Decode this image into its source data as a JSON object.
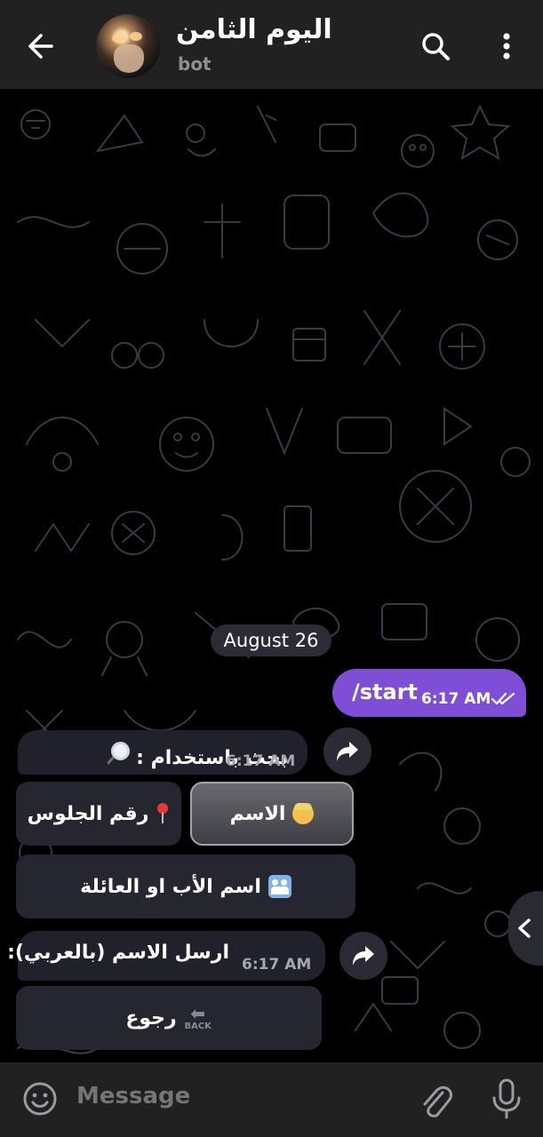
{
  "header": {
    "title": "اليوم الثامن",
    "subtitle": "bot",
    "icons": {
      "back": "arrow-left",
      "search": "search",
      "menu": "more-vertical"
    }
  },
  "chat": {
    "date_chip": "August 26",
    "outgoing": {
      "text": "/start",
      "time": "6:17 AM",
      "status": "read"
    },
    "incoming_1": {
      "text": "🔎 بحث باستخدام :",
      "text_main": "بحث باستخدام :",
      "time": "6:17 AM"
    },
    "keyboard_1": {
      "name_label": "الاسم",
      "seat_label": "رقم الجلوس",
      "father_label": "اسم الأب او العائلة"
    },
    "incoming_2": {
      "text": "ارسل الاسم (بالعربي):",
      "time": "6:17 AM"
    },
    "keyboard_2": {
      "back_label": "رجوع",
      "back_icon_text": "BACK"
    }
  },
  "input": {
    "placeholder": "Message"
  },
  "colors": {
    "header": "#212121",
    "accent": "#7e4fd6",
    "bubble_in": "#21212b",
    "wallpaper_doodle": "#3a3a46"
  }
}
